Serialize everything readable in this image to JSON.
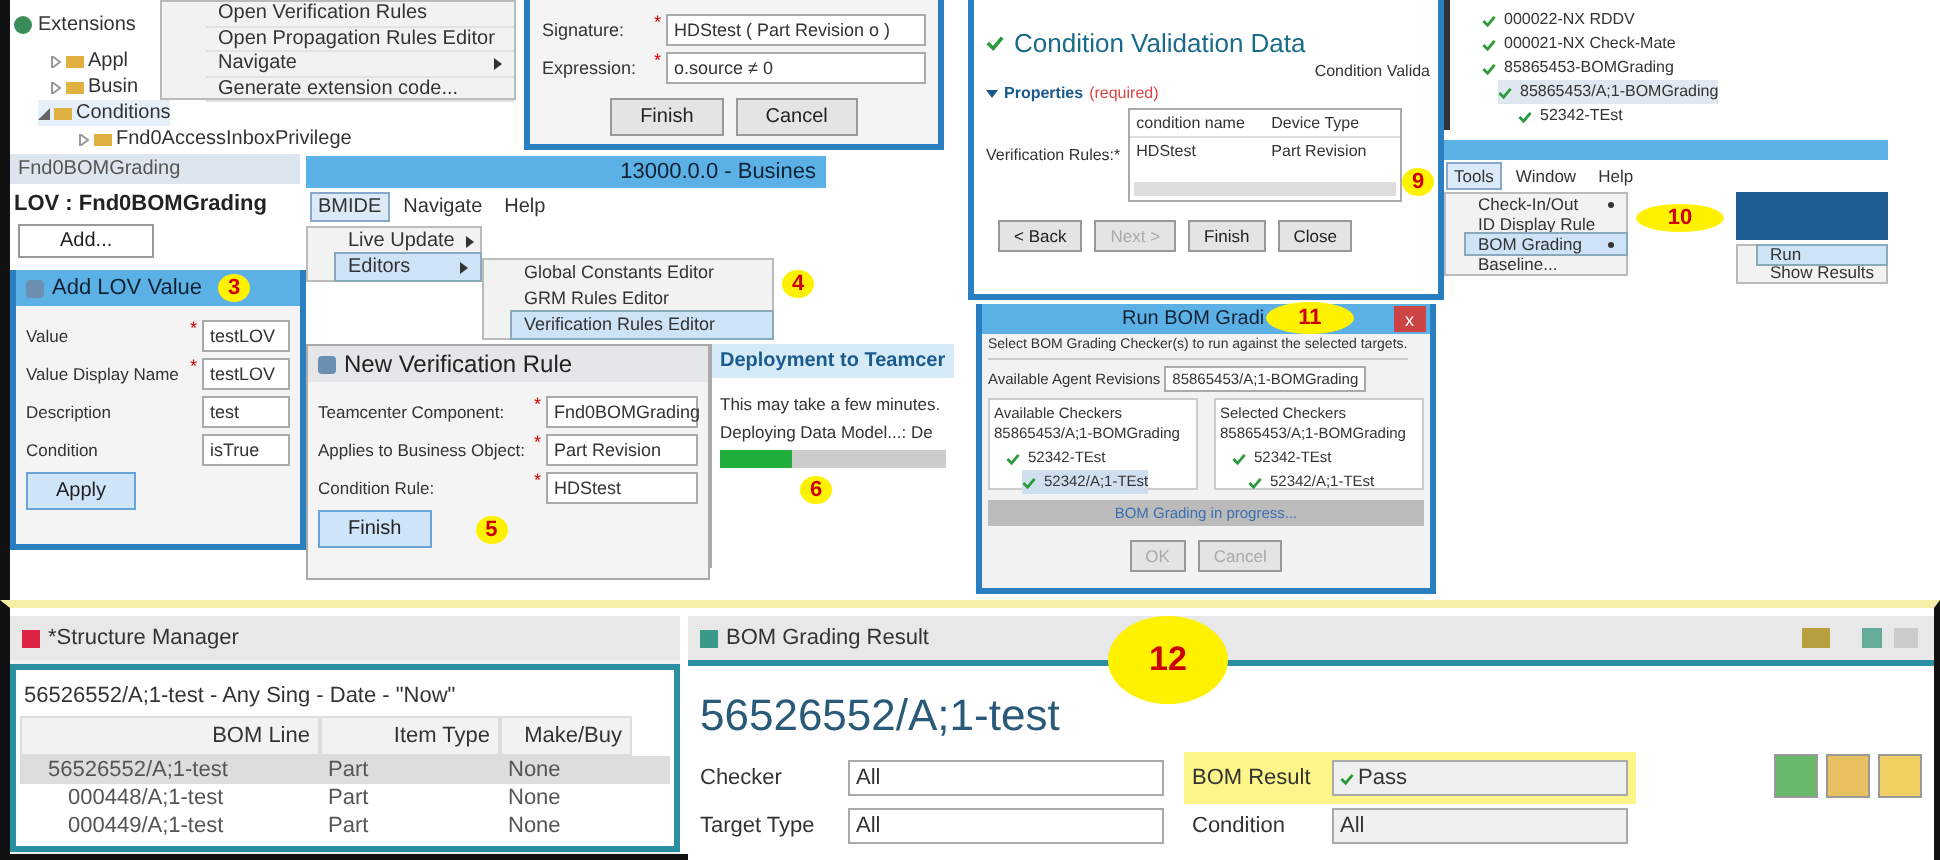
{
  "extensions": {
    "tab": "Extensions",
    "items": [
      {
        "label": "Appl",
        "expanded": false,
        "selected": false
      },
      {
        "label": "Busin",
        "expanded": false,
        "selected": false
      },
      {
        "label": "Conditions",
        "expanded": true,
        "selected": true
      },
      {
        "label": "Fnd0AccessInboxPrivilege",
        "expanded": false,
        "selected": false
      }
    ]
  },
  "context_menu": {
    "items": [
      {
        "label": "Open Verification Rules",
        "submenu": false
      },
      {
        "label": "Open Propagation Rules Editor",
        "submenu": false
      },
      {
        "label": "Navigate",
        "submenu": true
      },
      {
        "label": "Generate extension code...",
        "submenu": false
      }
    ]
  },
  "condition_dialog": {
    "fields": [
      {
        "label": "Signature:",
        "mark": "*",
        "value": "HDStest ( Part Revision o )"
      },
      {
        "label": "Expression:",
        "mark": "*",
        "value": "o.source ≠ 0"
      }
    ],
    "buttons": [
      "Finish",
      "Cancel"
    ]
  },
  "lov_editor": {
    "tab": "Fnd0BOMGrading",
    "title": "LOV : Fnd0BOMGrading",
    "button": "Add..."
  },
  "add_lov_dialog": {
    "title": "Add LOV Value",
    "badge": "3",
    "fields": [
      {
        "label": "Value",
        "mark": "*",
        "value": "testLOV"
      },
      {
        "label": "Value Display Name",
        "mark": "*",
        "value": "testLOV"
      },
      {
        "label": "Description",
        "value": "test"
      },
      {
        "label": "Condition",
        "value": "isTrue"
      }
    ],
    "button": "Apply"
  },
  "bmide_window": {
    "title": "13000.0.0 - Busines",
    "menu": [
      {
        "label": "BMIDE",
        "selected": true
      },
      {
        "label": "Navigate",
        "selected": false
      },
      {
        "label": "Help",
        "selected": false
      }
    ],
    "items": [
      {
        "label": "Live Update",
        "selected": false
      },
      {
        "label": "Editors",
        "selected": true
      }
    ],
    "submenu": [
      {
        "label": "Global Constants Editor",
        "selected": false
      },
      {
        "label": "GRM Rules Editor",
        "selected": false
      },
      {
        "label": "Verification Rules Editor",
        "selected": true
      }
    ],
    "badge": "4"
  },
  "new_rule_dialog": {
    "title": "New Verification Rule",
    "fields": [
      {
        "label": "Teamcenter Component:",
        "mark": "*",
        "value": "Fnd0BOMGrading"
      },
      {
        "label": "Applies to Business Object:",
        "mark": "*",
        "value": "Part Revision"
      },
      {
        "label": "Condition Rule:",
        "mark": "*",
        "value": "HDStest"
      }
    ],
    "button": "Finish",
    "badge": "5"
  },
  "deployment": {
    "title": "Deployment to Teamcer",
    "message": "This may take a few minutes.",
    "status": "Deploying Data Model...: De",
    "level": 0.32,
    "badge": "6"
  },
  "validation_data": {
    "title": "Condition Validation Data",
    "tab": "Condition Valida",
    "section": "Properties",
    "section_note": "(required)",
    "field_label": "Verification Rules:*",
    "columns": [
      "condition name",
      "Device Type"
    ],
    "rows": [
      [
        "HDStest",
        "Part Revision"
      ]
    ],
    "buttons": [
      {
        "label": "< Back",
        "disabled": false
      },
      {
        "label": "Next >",
        "disabled": true
      },
      {
        "label": "Finish",
        "disabled": false
      },
      {
        "label": "Close",
        "disabled": false
      }
    ],
    "badge": "9"
  },
  "validation_tree": {
    "items": [
      {
        "label": "000022-NX RDDV",
        "selected": false
      },
      {
        "label": "000021-NX Check-Mate",
        "selected": false
      },
      {
        "label": "85865453-BOMGrading",
        "selected": false,
        "children": [
          {
            "label": "85865453/A;1-BOMGrading",
            "selected": true,
            "children": [
              {
                "label": "52342-TEst",
                "selected": false
              }
            ]
          }
        ]
      }
    ]
  },
  "tools_menu": {
    "menu": [
      {
        "label": "Tools",
        "selected": true
      },
      {
        "label": "Window",
        "selected": false
      },
      {
        "label": "Help",
        "selected": false
      }
    ],
    "items": [
      {
        "label": "Check-In/Out",
        "submenu": true,
        "selected": false
      },
      {
        "label": "ID Display Rule",
        "submenu": false,
        "selected": false
      },
      {
        "label": "BOM Grading",
        "submenu": true,
        "selected": true
      },
      {
        "label": "Baseline...",
        "submenu": false,
        "selected": false
      }
    ],
    "submenu": [
      {
        "label": "Run",
        "selected": true
      },
      {
        "label": "Show Results",
        "selected": false
      }
    ],
    "badge": "10"
  },
  "run_dialog": {
    "title": "Run BOM Gradi",
    "close": "x",
    "badge": "11",
    "instruction": "Select BOM Grading Checker(s) to run against the selected targets.",
    "agent_label": "Available Agent Revisions",
    "agent_value": "85865453/A;1-BOMGrading",
    "available": {
      "title": "Available Checkers",
      "root": "85865453/A;1-BOMGrading",
      "child": "52342-TEst",
      "leaf": "52342/A;1-TEst",
      "leaf_selected": true
    },
    "chosen": {
      "title": "Selected Checkers",
      "root": "85865453/A;1-BOMGrading",
      "child": "52342-TEst",
      "leaf": "52342/A;1-TEst",
      "leaf_selected": false
    },
    "progress": "BOM Grading in progress...",
    "buttons": [
      "OK",
      "Cancel"
    ]
  },
  "structure_manager": {
    "tab": "*Structure Manager",
    "header": "56526552/A;1-test - Any Sing - Date - \"Now\"",
    "columns": [
      "BOM Line",
      "Item Type",
      "Make/Buy"
    ],
    "rows": [
      {
        "cells": [
          "56526552/A;1-test",
          "Part",
          "None"
        ],
        "selected": true,
        "child": false
      },
      {
        "cells": [
          "000448/A;1-test",
          "Part",
          "None"
        ],
        "selected": false,
        "child": true
      },
      {
        "cells": [
          "000449/A;1-test",
          "Part",
          "None"
        ],
        "selected": false,
        "child": true
      }
    ]
  },
  "grading_result": {
    "tab": "BOM Grading Result",
    "title": "56526552/A;1-test",
    "badge": "12",
    "fields": [
      {
        "label": "Checker",
        "value": "All"
      },
      {
        "label": "Target Type",
        "value": "All"
      }
    ],
    "result_label": "BOM Result",
    "result_value": "Pass",
    "condition_label": "Condition",
    "condition_value": "All"
  }
}
